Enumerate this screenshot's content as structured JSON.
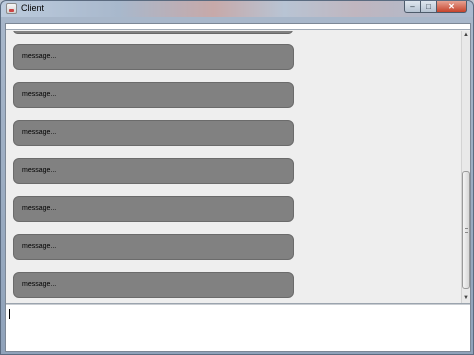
{
  "window": {
    "title": "Client",
    "minimize_glyph": "–",
    "maximize_glyph": "□",
    "close_glyph": "✕"
  },
  "messages": [
    "message...",
    "message...",
    "message...",
    "message...",
    "message...",
    "message...",
    "message..."
  ],
  "input": {
    "value": ""
  },
  "scrollbar": {
    "up_glyph": "▲",
    "down_glyph": "▼"
  }
}
